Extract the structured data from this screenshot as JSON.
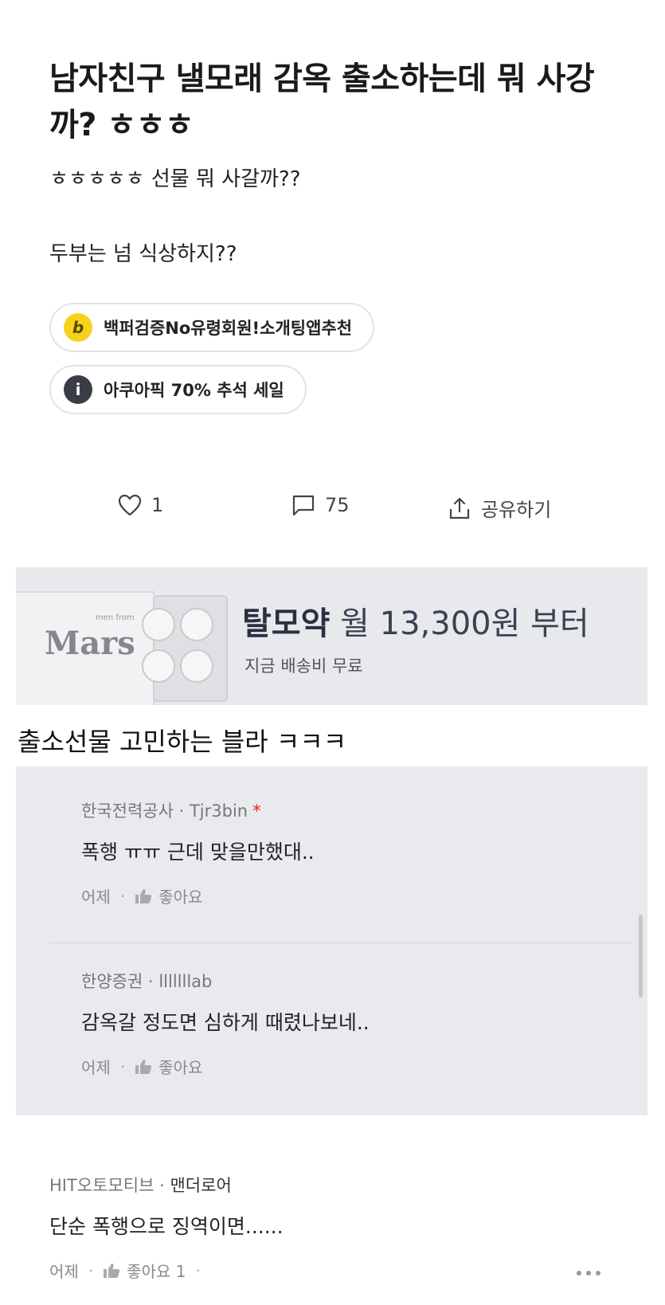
{
  "post": {
    "title": "남자친구 낼모래 감옥 출소하는데 뭐 사강까? ㅎㅎㅎ",
    "body_line1": "ㅎㅎㅎㅎㅎ 선물 뭐 사갈까??",
    "body_line2": "두부는 넘 식상하지??"
  },
  "chips": [
    {
      "icon_text": "b",
      "icon": "b-logo-icon",
      "label": "백퍼검증No유령회원!소개팅앱추천",
      "icon_color": "#f7d21b"
    },
    {
      "icon_text": "i",
      "icon": "info-icon",
      "label": "아쿠아픽 70% 추석 세일",
      "icon_color": "#3a3d45"
    }
  ],
  "actions": {
    "likes": "1",
    "comments": "75",
    "share_label": "공유하기"
  },
  "ad": {
    "brand": "Mars",
    "brand_sub": "men from",
    "headline_strong": "탈모약",
    "headline_rest": " 월 13,300원 부터",
    "subtext": "지금 배송비 무료"
  },
  "caption": "출소선물 고민하는 블라 ㅋㅋㅋ",
  "comments": [
    {
      "company": "한국전력공사",
      "user": "Tjr3bin",
      "star": "*",
      "text": "폭행 ㅠㅠ 근데 맞을만했대..",
      "time": "어제",
      "like_label": "좋아요"
    },
    {
      "company": "한양증권",
      "user": "lllllllab",
      "text": "감옥갈 정도면 심하게 때렸나보네..",
      "time": "어제",
      "like_label": "좋아요"
    },
    {
      "company": "HIT오토모티브",
      "user": "맨더로어",
      "text": "단순 폭행으로 징역이면......",
      "time": "어제",
      "like_label": "좋아요 1"
    }
  ],
  "separator": "·"
}
